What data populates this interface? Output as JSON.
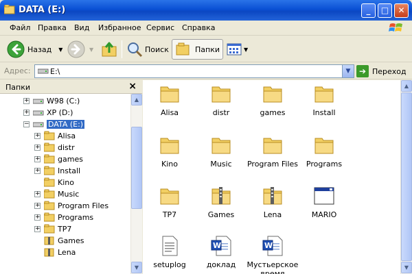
{
  "window": {
    "title": "DATA (E:)"
  },
  "menu": [
    "Файл",
    "Правка",
    "Вид",
    "Избранное",
    "Сервис",
    "Справка"
  ],
  "toolbar": {
    "back": "Назад",
    "search": "Поиск",
    "folders": "Папки"
  },
  "address": {
    "label": "Адрес:",
    "value": "E:\\",
    "go": "Переход"
  },
  "leftpane": {
    "title": "Папки"
  },
  "tree": [
    {
      "label": "W98 (C:)",
      "icon": "drive-icon",
      "expander": "+"
    },
    {
      "label": "XP (D:)",
      "icon": "drive-icon",
      "expander": "+"
    },
    {
      "label": "DATA (E:)",
      "icon": "drive-icon",
      "expander": "-",
      "selected": true
    },
    {
      "label": "Alisa",
      "icon": "folder-icon",
      "expander": "+"
    },
    {
      "label": "distr",
      "icon": "folder-icon",
      "expander": "+"
    },
    {
      "label": "games",
      "icon": "folder-icon",
      "expander": "+"
    },
    {
      "label": "Install",
      "icon": "folder-icon",
      "expander": "+"
    },
    {
      "label": "Kino",
      "icon": "folder-icon",
      "expander": ""
    },
    {
      "label": "Music",
      "icon": "folder-icon",
      "expander": "+"
    },
    {
      "label": "Program Files",
      "icon": "folder-icon",
      "expander": "+"
    },
    {
      "label": "Programs",
      "icon": "folder-icon",
      "expander": "+"
    },
    {
      "label": "TP7",
      "icon": "folder-icon",
      "expander": "+"
    },
    {
      "label": "Games",
      "icon": "zip-folder-icon",
      "expander": ""
    },
    {
      "label": "Lena",
      "icon": "zip-folder-icon",
      "expander": ""
    }
  ],
  "files": [
    {
      "label": "Alisa",
      "icon": "folder-icon"
    },
    {
      "label": "distr",
      "icon": "folder-icon"
    },
    {
      "label": "games",
      "icon": "folder-icon"
    },
    {
      "label": "Install",
      "icon": "folder-icon"
    },
    {
      "label": "Kino",
      "icon": "folder-icon"
    },
    {
      "label": "Music",
      "icon": "folder-icon"
    },
    {
      "label": "Program Files",
      "icon": "folder-icon"
    },
    {
      "label": "Programs",
      "icon": "folder-icon"
    },
    {
      "label": "TP7",
      "icon": "folder-icon"
    },
    {
      "label": "Games",
      "icon": "zip-folder-icon"
    },
    {
      "label": "Lena",
      "icon": "zip-folder-icon"
    },
    {
      "label": "MARIO",
      "icon": "application-icon"
    },
    {
      "label": "setuplog",
      "icon": "text-file-icon"
    },
    {
      "label": "доклад",
      "icon": "word-document-icon"
    },
    {
      "label": "Мустьерское время",
      "icon": "word-document-icon"
    }
  ],
  "colors": {
    "titlebar": "#0a50d4",
    "selection": "#316ac5",
    "folder": "#f0c95c"
  }
}
